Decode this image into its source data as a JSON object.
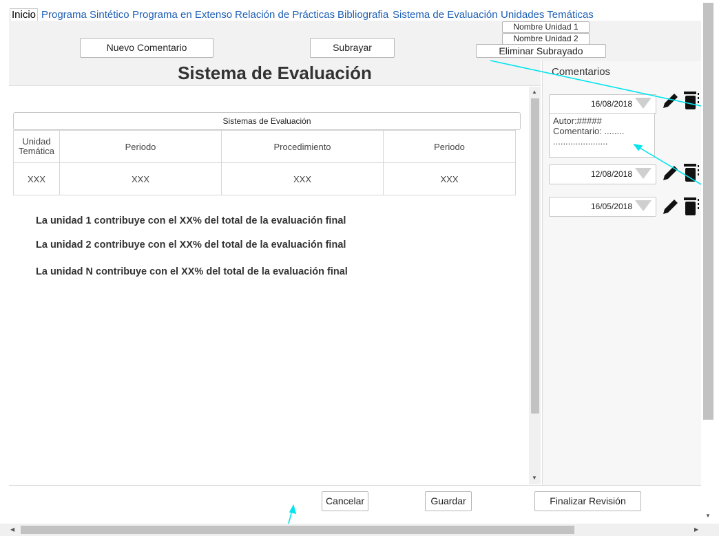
{
  "nav": {
    "items": [
      {
        "label": "Inicio",
        "active": true
      },
      {
        "label": "Programa Sintético"
      },
      {
        "label": "Programa en Extenso"
      },
      {
        "label": "Relación de Prácticas"
      },
      {
        "label": "Bibliografia"
      },
      {
        "label": "Sistema de Evaluación"
      },
      {
        "label": "Unidades Temáticas"
      }
    ]
  },
  "toolbar": {
    "new_comment": "Nuevo Comentario",
    "underline": "Subrayar",
    "unit1": "Nombre Unidad 1",
    "unit2": "Nombre Unidad 2",
    "remove_underline": "Eliminar Subrayado"
  },
  "main": {
    "title": "Sistema de Evaluación",
    "table_title": "Sistemas de Evaluación",
    "headers": [
      "Unidad Temática",
      "Periodo",
      "Procedimiento",
      "Periodo"
    ],
    "row": [
      "XXX",
      "XXX",
      "XXX",
      "XXX"
    ],
    "units": [
      "La unidad 1 contribuye con el XX% del total de la evaluación final",
      "La unidad 2 contribuye con el XX% del total de la evaluación final",
      "La unidad N contribuye con el XX% del total de la evaluación final"
    ]
  },
  "comments": {
    "header": "Comentarios",
    "items": [
      {
        "date": "16/08/2018",
        "author": "Autor:#####",
        "comment": "Comentario: ........",
        "more": "......................"
      },
      {
        "date": "12/08/2018"
      },
      {
        "date": "16/05/2018"
      }
    ]
  },
  "footer": {
    "cancel": "Cancelar",
    "save": "Guardar",
    "finish": "Finalizar Revisión"
  },
  "colors": {
    "link": "#1d5fb5",
    "annotation": "#00e5ee"
  }
}
